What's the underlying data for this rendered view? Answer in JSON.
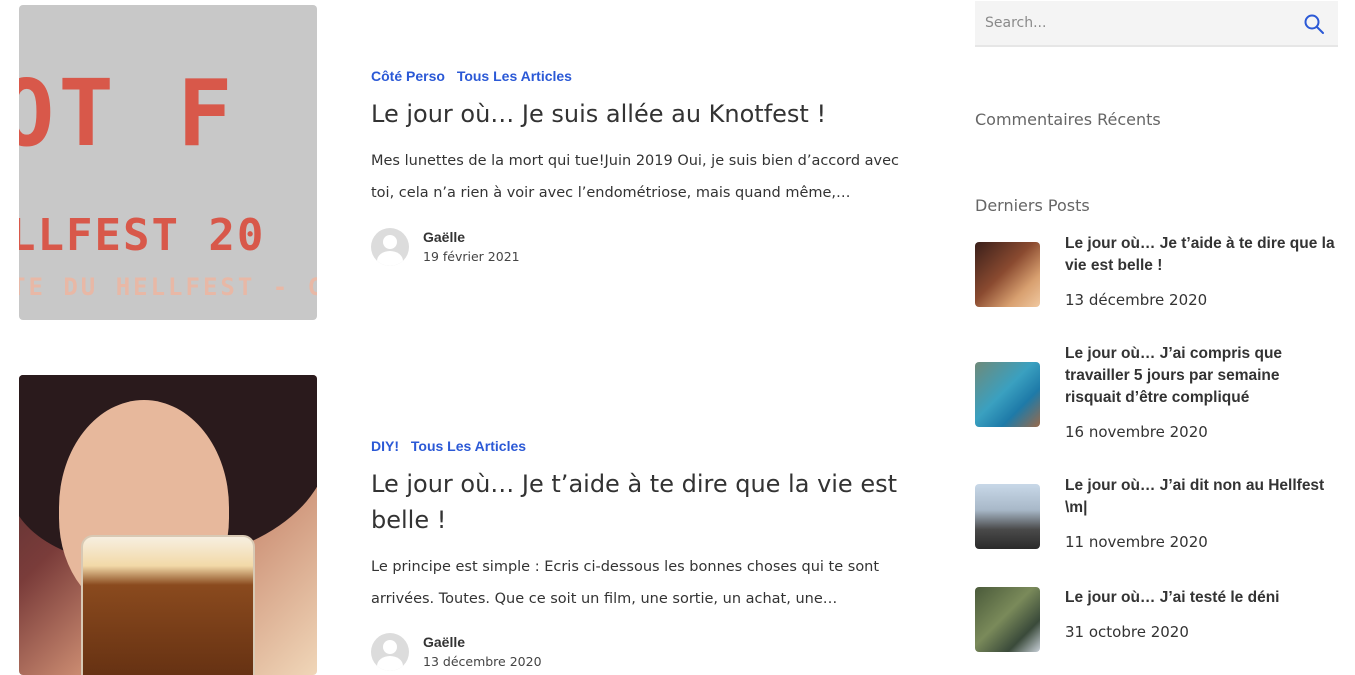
{
  "articles": [
    {
      "categories": [
        "Côté Perso",
        "Tous Les Articles"
      ],
      "title": "Le jour où… Je suis allée au Knotfest !",
      "excerpt": "Mes lunettes de la mort qui tue!Juin 2019 Oui, je suis bien d’accord avec toi, cela n’a rien à voir avec l’endométriose, mais quand même,…",
      "author": "Gaëlle",
      "date": "19 février 2021",
      "image_text": {
        "big": "OT F",
        "mid": "LLFEST 20",
        "small": "TE DU HELLFEST - C"
      }
    },
    {
      "categories": [
        "DIY!",
        "Tous Les Articles"
      ],
      "title": "Le jour où… Je t’aide à te dire que la vie est belle !",
      "excerpt": "Le principe est simple :   Ecris ci-dessous les bonnes choses qui te sont arrivées. Toutes. Que ce soit un film, une sortie, un achat, une…",
      "author": "Gaëlle",
      "date": "13 décembre 2020"
    }
  ],
  "sidebar": {
    "search": {
      "placeholder": "Search..."
    },
    "recent_comments_title": "Commentaires Récents",
    "latest_posts_title": "Derniers Posts",
    "posts": [
      {
        "title": "Le jour où… Je t’aide à te dire que la vie est belle !",
        "date": "13 décembre 2020"
      },
      {
        "title": "Le jour où… J’ai compris que travailler 5 jours par semaine risquait d’être compliqué",
        "date": "16 novembre 2020"
      },
      {
        "title": "Le jour où… J’ai dit non au Hellfest \\m|",
        "date": "11 novembre 2020"
      },
      {
        "title": "Le jour où… J’ai testé le déni",
        "date": "31 octobre 2020"
      }
    ]
  },
  "colors": {
    "accent": "#2b59d6",
    "text": "#333333",
    "muted": "#666666"
  },
  "icons": {
    "search": "search-icon",
    "avatar": "user-avatar-icon"
  }
}
